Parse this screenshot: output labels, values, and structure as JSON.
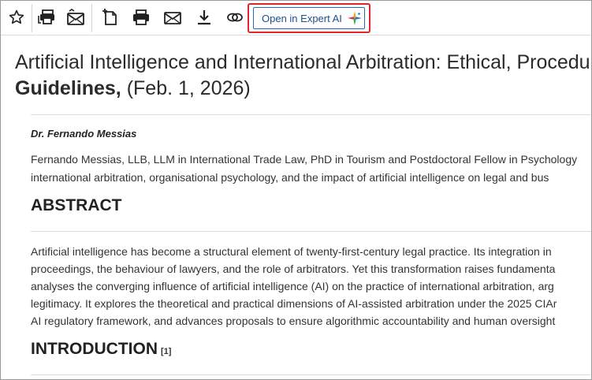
{
  "toolbar": {
    "icons": [
      "star-icon",
      "print-stack-icon",
      "email-stack-icon",
      "new-document-icon",
      "print-icon",
      "email-icon",
      "download-icon",
      "link-icon"
    ],
    "expert_button_label": "Open in Expert AI"
  },
  "document": {
    "title_line1": "Artificial Intelligence and International Arbitration: Ethical, Procedural",
    "title_line2_bold": "Guidelines,",
    "title_line2_date": " (Feb. 1, 2026)",
    "author": "Dr. Fernando Messias",
    "bio_lines": [
      "Fernando Messias, LLB, LLM in International Trade Law, PhD in Tourism and Postdoctoral Fellow in Psychology",
      "international arbitration, organisational psychology, and the impact of artificial intelligence on legal and bus"
    ],
    "abstract_heading": "ABSTRACT",
    "abstract_lines": [
      "Artificial intelligence has become a structural element of twenty-first-century legal practice. Its integration in",
      "proceedings, the behaviour of lawyers, and the role of arbitrators. Yet this transformation raises fundamenta",
      "analyses the converging influence of artificial intelligence (AI) on the practice of international arbitration, arg",
      "legitimacy. It explores the theoretical and practical dimensions of AI-assisted arbitration under the 2025 CIAr",
      "AI regulatory framework, and advances proposals to ensure algorithmic accountability and human oversight"
    ],
    "intro_heading": "INTRODUCTION",
    "intro_footnote": "[1]"
  }
}
